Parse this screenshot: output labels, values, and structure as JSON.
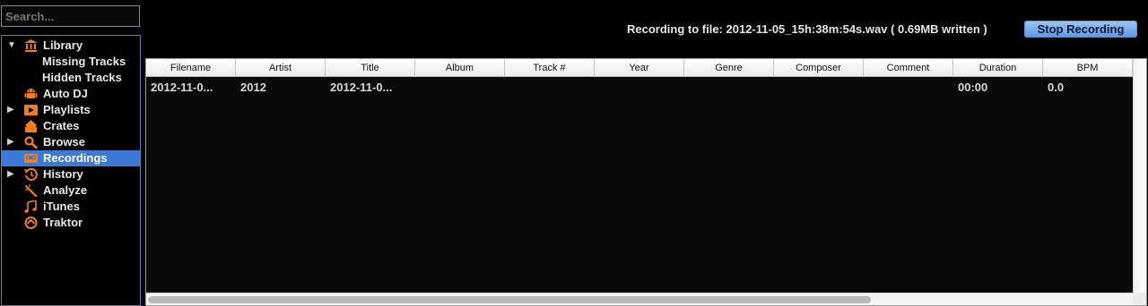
{
  "search": {
    "placeholder": "Search..."
  },
  "sidebar": {
    "items": [
      {
        "label": "Library",
        "icon": "library-icon",
        "expandable": true,
        "expanded": true
      },
      {
        "label": "Missing Tracks",
        "sub": true
      },
      {
        "label": "Hidden Tracks",
        "sub": true
      },
      {
        "label": "Auto DJ",
        "icon": "android-robot-icon"
      },
      {
        "label": "Playlists",
        "icon": "playlist-icon",
        "expandable": true
      },
      {
        "label": "Crates",
        "icon": "crate-icon"
      },
      {
        "label": "Browse",
        "icon": "magnifier-icon",
        "expandable": true
      },
      {
        "label": "Recordings",
        "icon": "cassette-icon",
        "selected": true
      },
      {
        "label": "History",
        "icon": "history-icon",
        "expandable": true
      },
      {
        "label": "Analyze",
        "icon": "wand-icon"
      },
      {
        "label": "iTunes",
        "icon": "music-note-icon"
      },
      {
        "label": "Traktor",
        "icon": "traktor-icon"
      }
    ]
  },
  "recording": {
    "status": "Recording to file: 2012-11-05_15h:38m:54s.wav ( 0.69MB written )",
    "stop_label": "Stop Recording"
  },
  "table": {
    "columns": [
      "Filename",
      "Artist",
      "Title",
      "Album",
      "Track #",
      "Year",
      "Genre",
      "Composer",
      "Comment",
      "Duration",
      "BPM"
    ],
    "rows": [
      [
        "2012-11-0...",
        "2012",
        "2012-11-0...",
        "",
        "",
        "",
        "",
        "",
        "",
        "00:00",
        "0.0"
      ]
    ]
  },
  "colors": {
    "accent": "#3d7ad6",
    "icon_orange": "#f07d1e",
    "button_blue": "#7ab0ee"
  }
}
